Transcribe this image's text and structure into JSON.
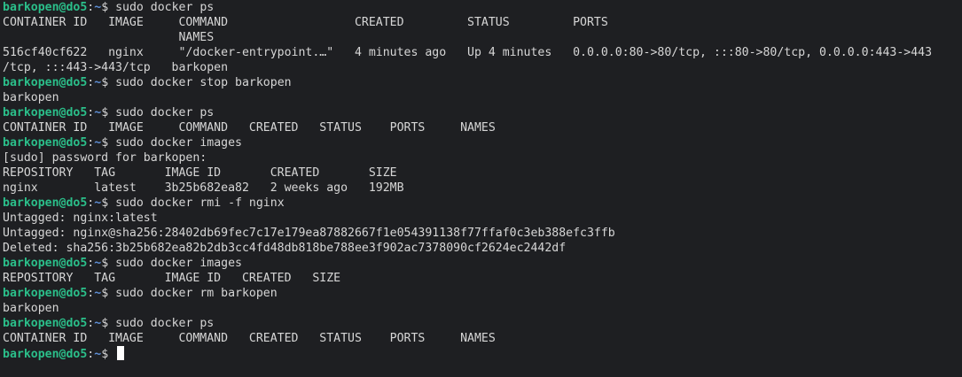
{
  "terminal": {
    "lines": [
      {
        "type": "prompt",
        "user": "barkopen@do5",
        "sep": ":",
        "path": "~",
        "symbol": "$ ",
        "cmd": "sudo docker ps"
      },
      {
        "type": "output",
        "text": "CONTAINER ID   IMAGE     COMMAND                  CREATED         STATUS         PORTS"
      },
      {
        "type": "output",
        "text": "                         NAMES"
      },
      {
        "type": "output",
        "text": "516cf40cf622   nginx     \"/docker-entrypoint.…\"   4 minutes ago   Up 4 minutes   0.0.0.0:80->80/tcp, :::80->80/tcp, 0.0.0.0:443->443"
      },
      {
        "type": "output",
        "text": "/tcp, :::443->443/tcp   barkopen"
      },
      {
        "type": "prompt",
        "user": "barkopen@do5",
        "sep": ":",
        "path": "~",
        "symbol": "$ ",
        "cmd": "sudo docker stop barkopen"
      },
      {
        "type": "output",
        "text": "barkopen"
      },
      {
        "type": "prompt",
        "user": "barkopen@do5",
        "sep": ":",
        "path": "~",
        "symbol": "$ ",
        "cmd": "sudo docker ps"
      },
      {
        "type": "output",
        "text": "CONTAINER ID   IMAGE     COMMAND   CREATED   STATUS    PORTS     NAMES"
      },
      {
        "type": "prompt",
        "user": "barkopen@do5",
        "sep": ":",
        "path": "~",
        "symbol": "$ ",
        "cmd": "sudo docker images"
      },
      {
        "type": "output",
        "text": "[sudo] password for barkopen:"
      },
      {
        "type": "output",
        "text": "REPOSITORY   TAG       IMAGE ID       CREATED       SIZE"
      },
      {
        "type": "output",
        "text": "nginx        latest    3b25b682ea82   2 weeks ago   192MB"
      },
      {
        "type": "prompt",
        "user": "barkopen@do5",
        "sep": ":",
        "path": "~",
        "symbol": "$ ",
        "cmd": "sudo docker rmi -f nginx"
      },
      {
        "type": "output",
        "text": "Untagged: nginx:latest"
      },
      {
        "type": "output",
        "text": "Untagged: nginx@sha256:28402db69fec7c17e179ea87882667f1e054391138f77ffaf0c3eb388efc3ffb"
      },
      {
        "type": "output",
        "text": "Deleted: sha256:3b25b682ea82b2db3cc4fd48db818be788ee3f902ac7378090cf2624ec2442df"
      },
      {
        "type": "prompt",
        "user": "barkopen@do5",
        "sep": ":",
        "path": "~",
        "symbol": "$ ",
        "cmd": "sudo docker images"
      },
      {
        "type": "output",
        "text": "REPOSITORY   TAG       IMAGE ID   CREATED   SIZE"
      },
      {
        "type": "prompt",
        "user": "barkopen@do5",
        "sep": ":",
        "path": "~",
        "symbol": "$ ",
        "cmd": "sudo docker rm barkopen"
      },
      {
        "type": "output",
        "text": "barkopen"
      },
      {
        "type": "prompt",
        "user": "barkopen@do5",
        "sep": ":",
        "path": "~",
        "symbol": "$ ",
        "cmd": "sudo docker ps"
      },
      {
        "type": "output",
        "text": "CONTAINER ID   IMAGE     COMMAND   CREATED   STATUS    PORTS     NAMES"
      },
      {
        "type": "prompt",
        "user": "barkopen@do5",
        "sep": ":",
        "path": "~",
        "symbol": "$ ",
        "cmd": "",
        "cursor": true
      }
    ]
  },
  "colors": {
    "background": "#1e1f22",
    "text": "#d6d6d6",
    "prompt_user": "#2bbf8a",
    "prompt_path": "#5f8fd6",
    "cursor": "#ffffff"
  }
}
